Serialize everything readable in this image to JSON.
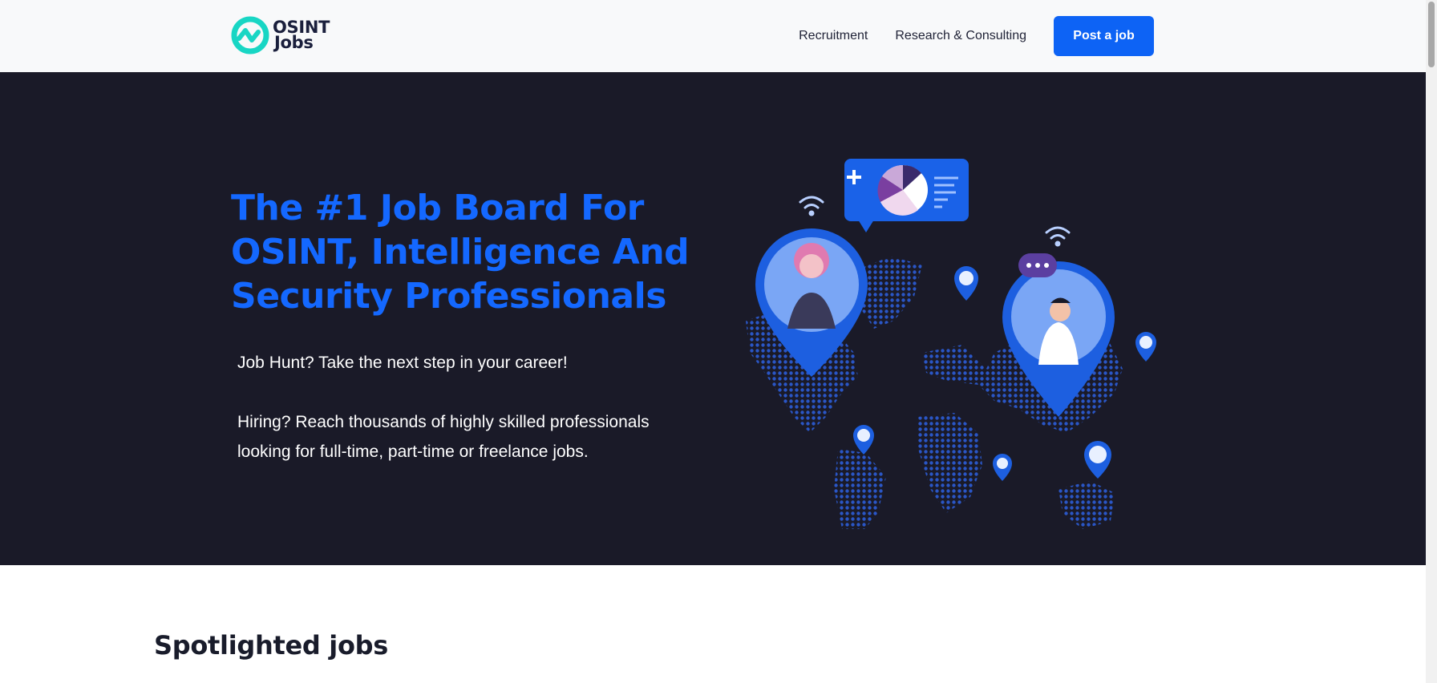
{
  "brand": {
    "line1": "OSINT",
    "line2": "Jobs"
  },
  "nav": {
    "recruitment": "Recruitment",
    "research": "Research & Consulting",
    "post_job": "Post a job"
  },
  "hero": {
    "title": "The #1 Job Board For OSINT, Intelligence And Security Professionals",
    "para1": "Job Hunt? Take the next step in your career!",
    "para2": "Hiring? Reach thousands of highly skilled professionals looking for full-time, part-time or freelance jobs."
  },
  "spotlight": {
    "title": "Spotlighted jobs"
  },
  "colors": {
    "accent": "#0d63f5",
    "hero_bg": "#1a1a28",
    "title_blue": "#1468ff",
    "logo_teal": "#18d6c4"
  },
  "icons": [
    "logo-mark-icon",
    "world-map-illustration",
    "wifi-icon",
    "map-pin-icon",
    "chat-bubble-icon",
    "pie-chart-icon"
  ]
}
